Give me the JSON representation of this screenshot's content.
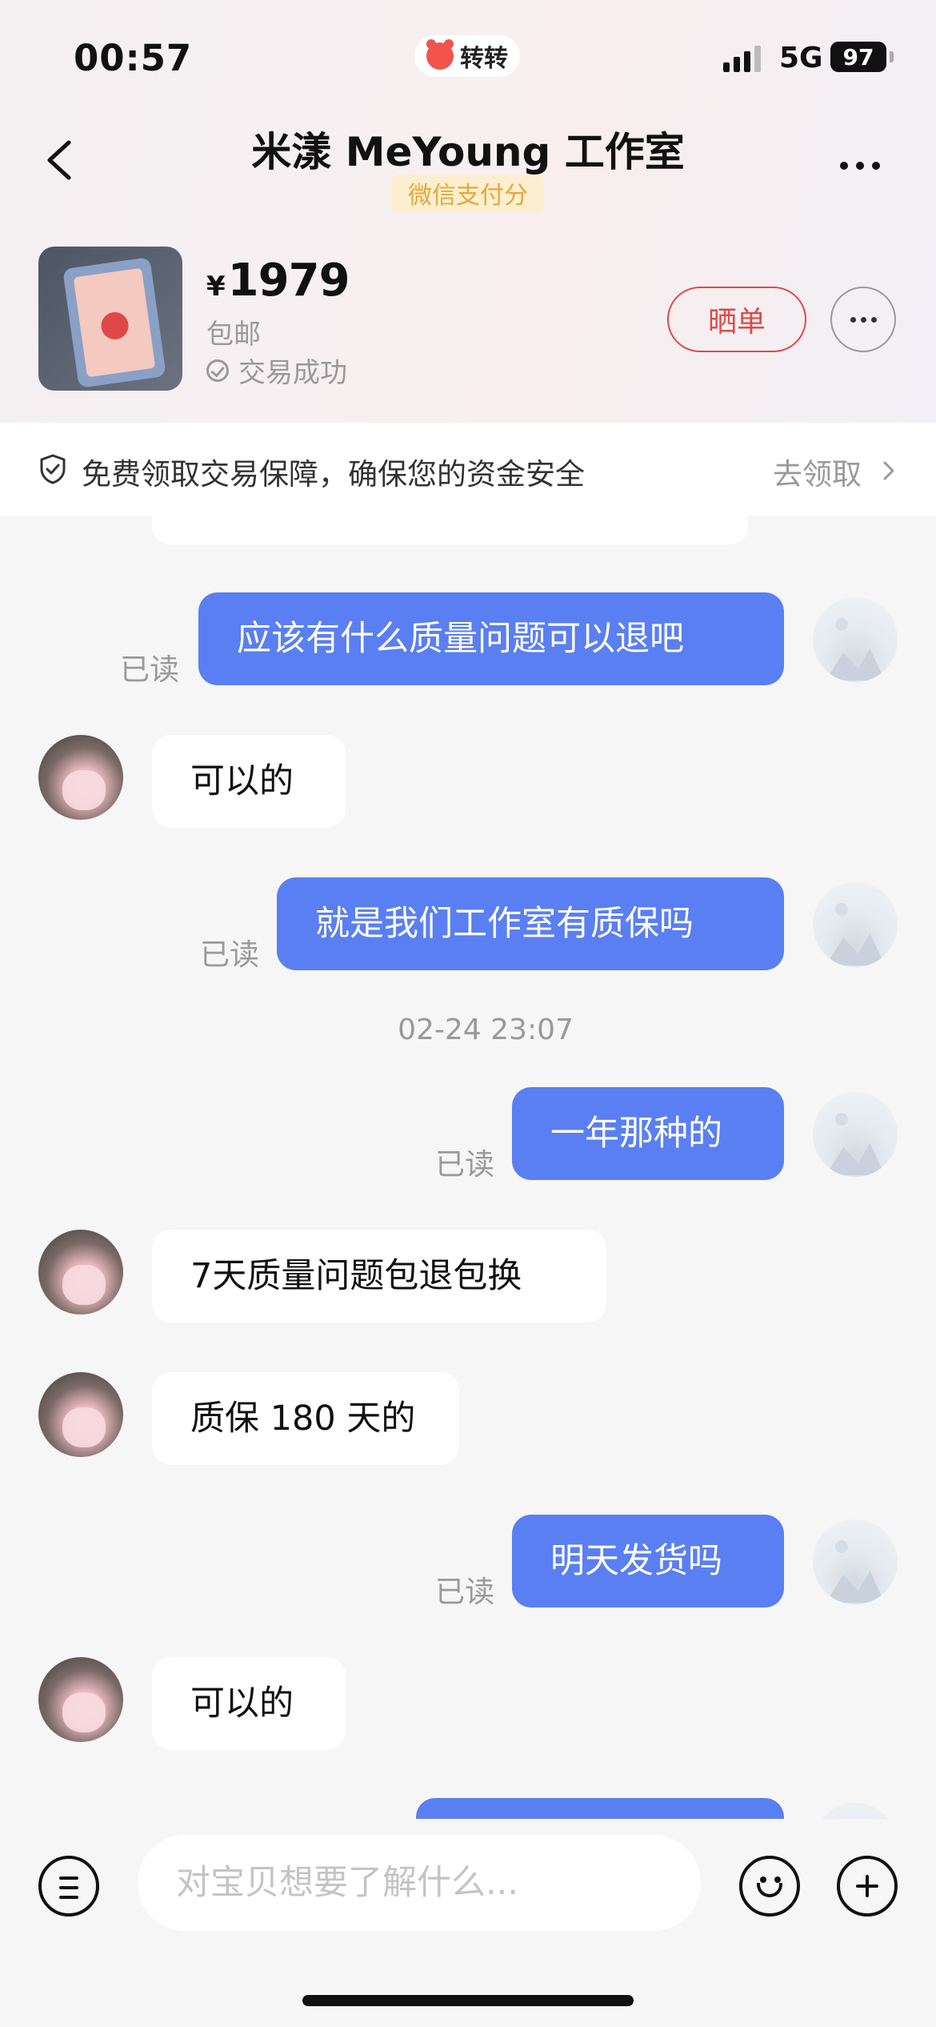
{
  "status_bar": {
    "time": "00:57",
    "app_name": "转转",
    "network": "5G",
    "battery": "97"
  },
  "header": {
    "title": "米漾 MeYoung 工作室",
    "score_badge": "微信支付分"
  },
  "product": {
    "currency": "¥",
    "price": "1979",
    "shipping": "包邮",
    "status": "交易成功",
    "share_label": "晒单"
  },
  "guarantee": {
    "text": "免费领取交易保障，确保您的资金安全",
    "link": "去领取"
  },
  "messages": [
    {
      "side": "out",
      "text": "应该有什么质量问题可以退吧",
      "read": "已读"
    },
    {
      "side": "in",
      "text": "可以的"
    },
    {
      "side": "out",
      "text": "就是我们工作室有质保吗",
      "read": "已读"
    },
    {
      "timestamp": "02-24 23:07"
    },
    {
      "side": "out",
      "text": "一年那种的",
      "read": "已读"
    },
    {
      "side": "in",
      "text": "7天质量问题包退包换"
    },
    {
      "side": "in",
      "text": "质保 180 天的"
    },
    {
      "side": "out",
      "text": "明天发货吗",
      "read": "已读"
    },
    {
      "side": "in",
      "text": "可以的"
    }
  ],
  "input": {
    "placeholder": "对宝贝想要了解什么..."
  },
  "colors": {
    "outgoing_bubble": "#5a7ff2",
    "incoming_bubble": "#ffffff",
    "accent_red": "#e04848",
    "badge_text": "#e5a83a"
  },
  "icons": [
    "back-icon",
    "more-icon",
    "check-circle-icon",
    "shield-icon",
    "chevron-right-icon",
    "menu-icon",
    "emoji-icon",
    "plus-icon"
  ]
}
